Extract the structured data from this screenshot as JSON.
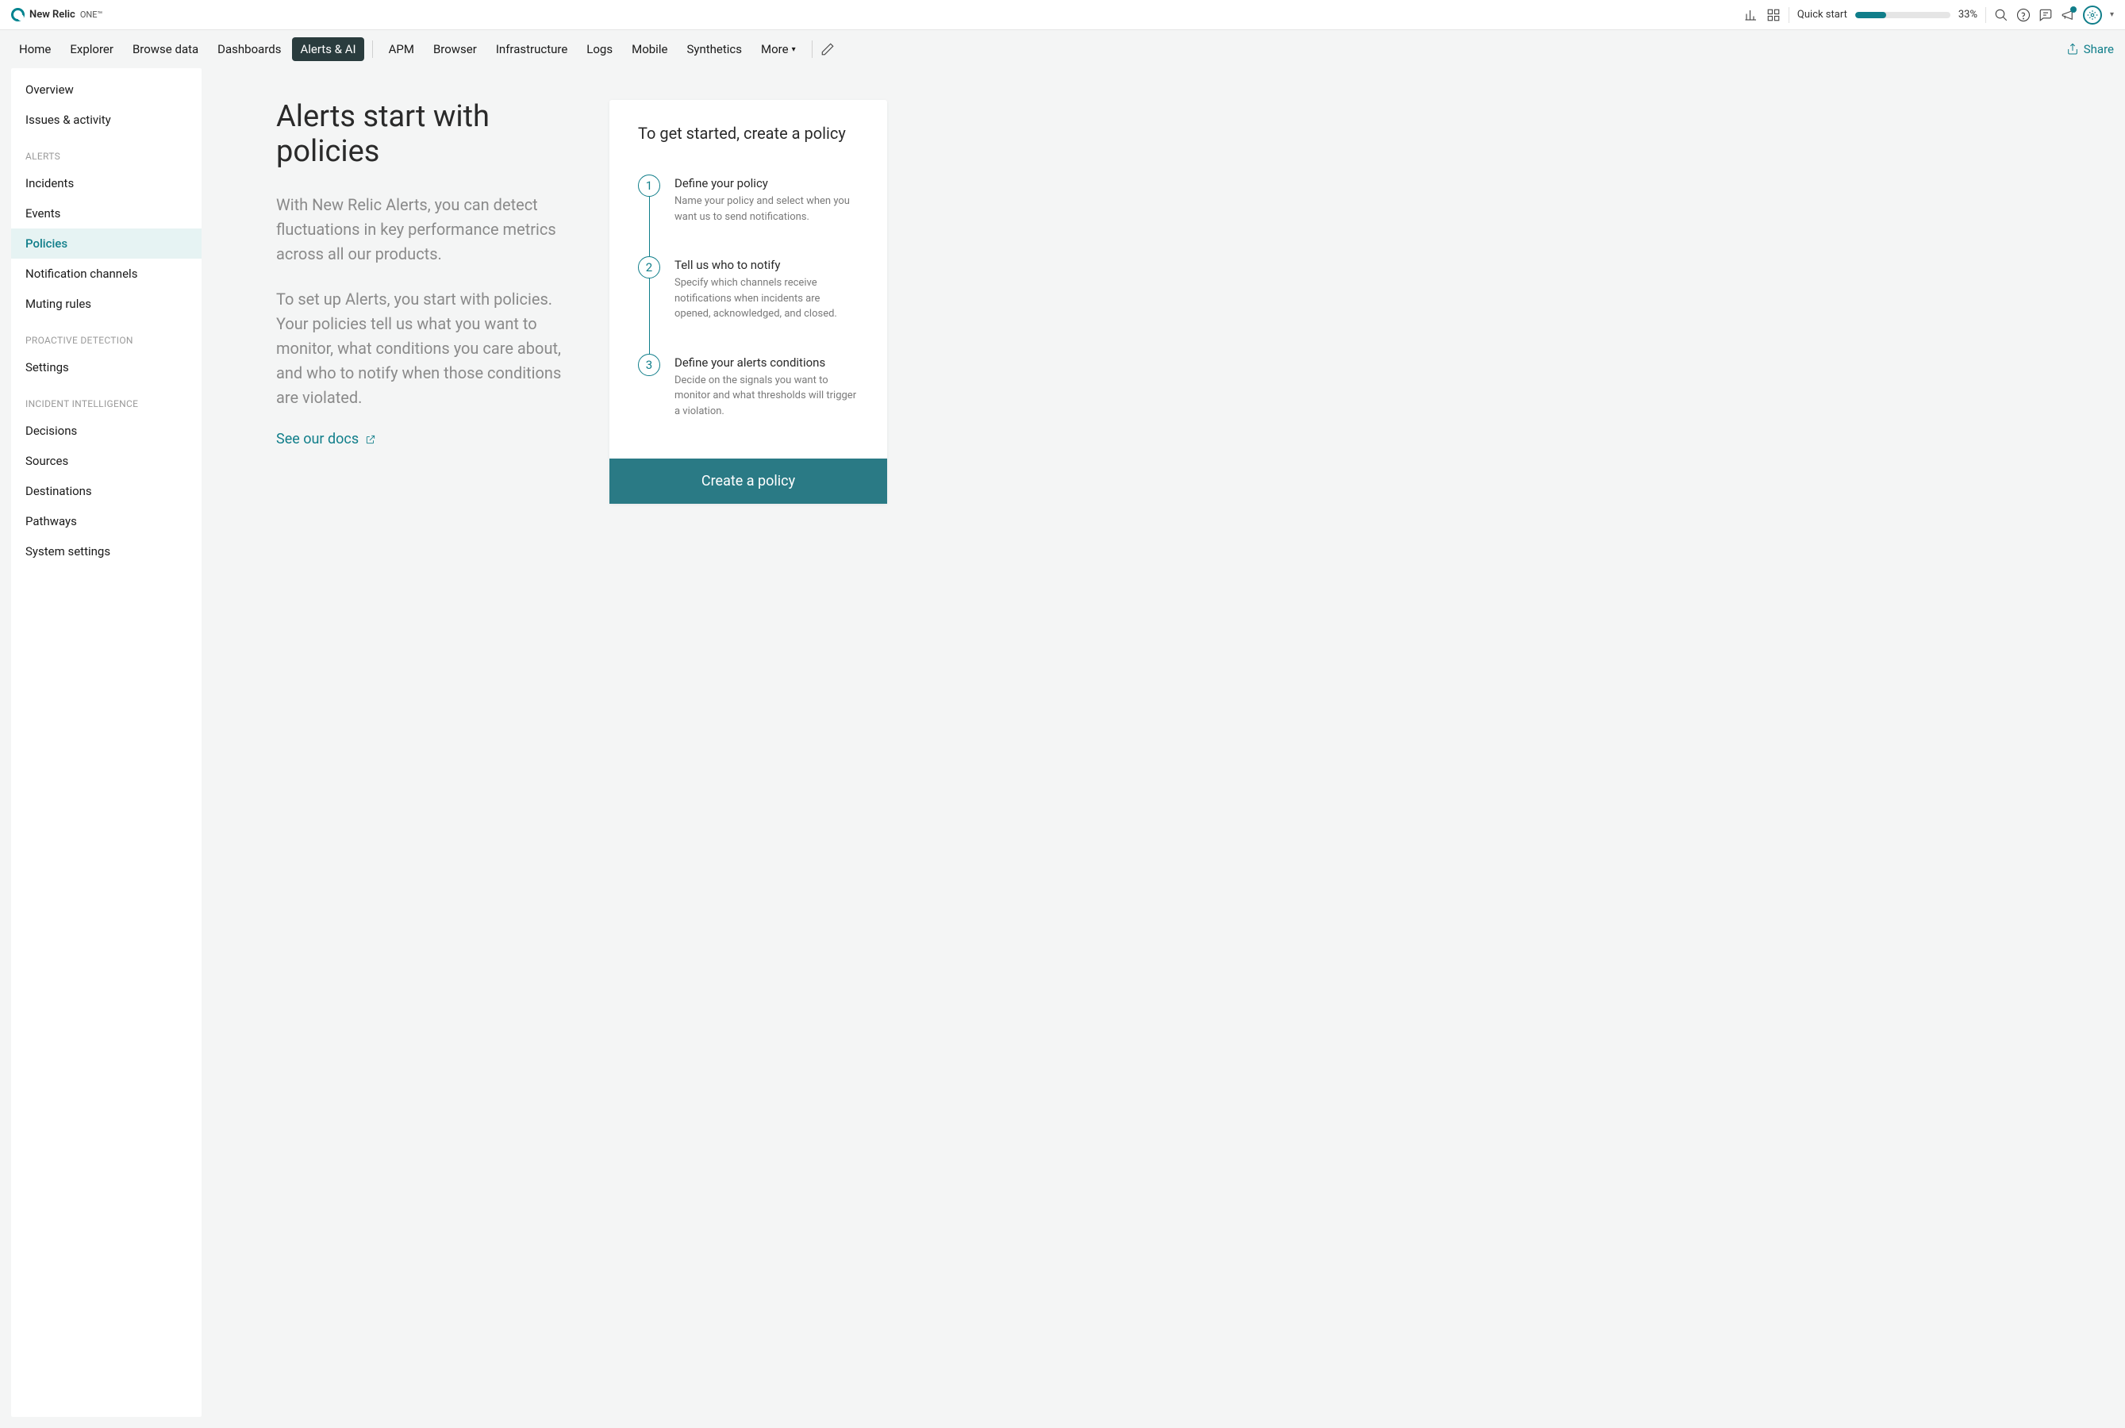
{
  "brand": {
    "name": "New Relic",
    "suffix": "ONE™"
  },
  "quickstart": {
    "label": "Quick start",
    "percent": 33
  },
  "nav": {
    "items": [
      {
        "label": "Home"
      },
      {
        "label": "Explorer"
      },
      {
        "label": "Browse data"
      },
      {
        "label": "Dashboards"
      },
      {
        "label": "Alerts & AI",
        "active": true
      },
      {
        "label": "APM"
      },
      {
        "label": "Browser"
      },
      {
        "label": "Infrastructure"
      },
      {
        "label": "Logs"
      },
      {
        "label": "Mobile"
      },
      {
        "label": "Synthetics"
      },
      {
        "label": "More"
      }
    ],
    "share": "Share"
  },
  "sidebar": {
    "top": [
      {
        "label": "Overview"
      },
      {
        "label": "Issues & activity"
      }
    ],
    "sections": [
      {
        "header": "ALERTS",
        "items": [
          {
            "label": "Incidents"
          },
          {
            "label": "Events"
          },
          {
            "label": "Policies",
            "active": true
          },
          {
            "label": "Notification channels"
          },
          {
            "label": "Muting rules"
          }
        ]
      },
      {
        "header": "PROACTIVE DETECTION",
        "items": [
          {
            "label": "Settings"
          }
        ]
      },
      {
        "header": "INCIDENT INTELLIGENCE",
        "items": [
          {
            "label": "Decisions"
          },
          {
            "label": "Sources"
          },
          {
            "label": "Destinations"
          },
          {
            "label": "Pathways"
          },
          {
            "label": "System settings"
          }
        ]
      }
    ]
  },
  "hero": {
    "title": "Alerts start with policies",
    "p1": "With New Relic Alerts, you can detect fluctuations in key performance metrics across all our products.",
    "p2": "To set up Alerts, you start with policies. Your policies tell us what you want to monitor, what conditions you care about, and who to notify when those conditions are violated.",
    "docs": "See our docs"
  },
  "card": {
    "title": "To get started, create a policy",
    "steps": [
      {
        "num": "1",
        "title": "Define your policy",
        "desc": "Name your policy and select when you want us to send notifications."
      },
      {
        "num": "2",
        "title": "Tell us who to notify",
        "desc": "Specify which channels receive notifications when incidents are opened, acknowledged, and closed."
      },
      {
        "num": "3",
        "title": "Define your alerts conditions",
        "desc": "Decide on the signals you want to monitor and what thresholds will trigger a violation."
      }
    ],
    "cta": "Create a policy"
  }
}
